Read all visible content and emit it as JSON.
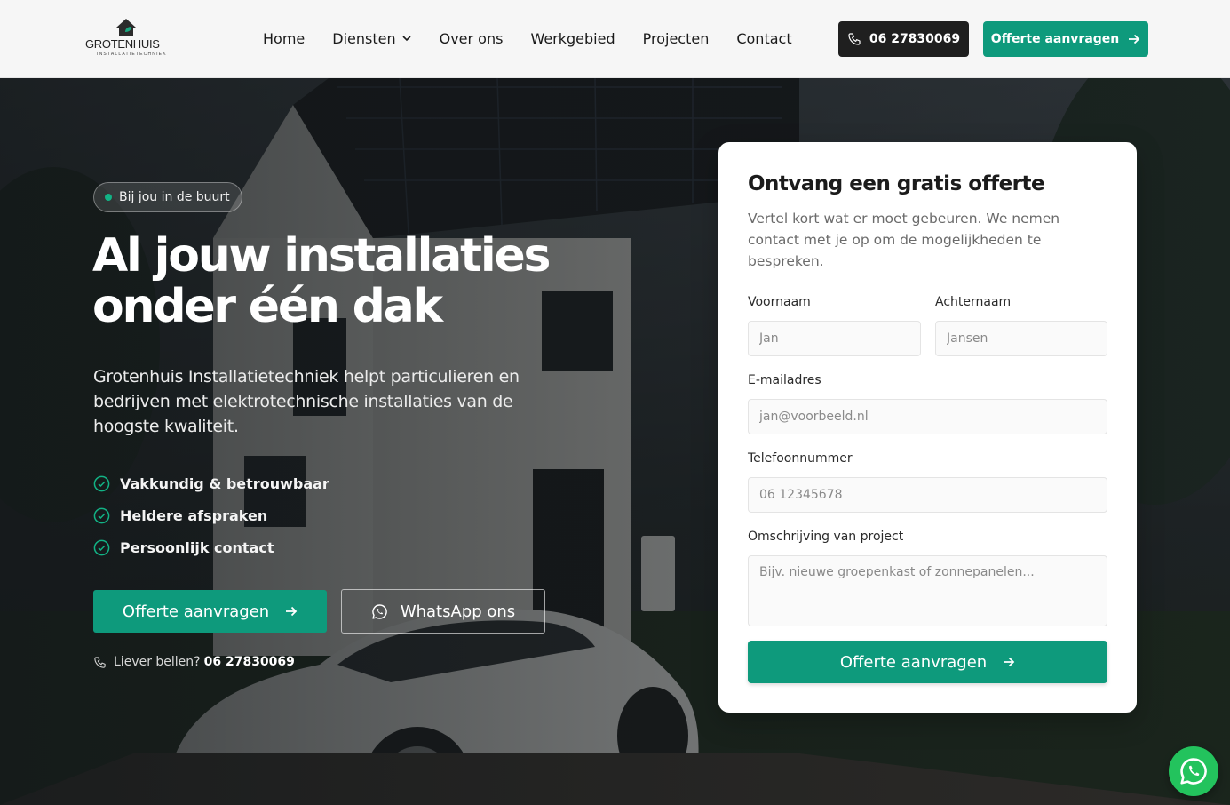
{
  "brand": {
    "name": "GROTENHUIS",
    "tagline": "INSTALLATIETECHNIEK",
    "accent": "#0e9a7c",
    "dark": "#1f1f1f"
  },
  "nav": {
    "items": [
      {
        "label": "Home"
      },
      {
        "label": "Diensten",
        "has_dropdown": true
      },
      {
        "label": "Over ons"
      },
      {
        "label": "Werkgebied"
      },
      {
        "label": "Projecten"
      },
      {
        "label": "Contact"
      }
    ],
    "phone": "06 27830069",
    "cta": "Offerte aanvragen"
  },
  "hero": {
    "badge": "Bij jou in de buurt",
    "title_line1": "Al jouw installaties",
    "title_line2": "onder één dak",
    "description": "Grotenhuis Installatietechniek helpt particulieren en bedrijven met elektrotechnische installaties van de hoogste kwaliteit.",
    "features": [
      "Vakkundig & betrouwbaar",
      "Heldere afspraken",
      "Persoonlijk contact"
    ],
    "primary_button": "Offerte aanvragen",
    "secondary_button": "WhatsApp ons",
    "call_prefix": "Liever bellen?",
    "call_number": "06 27830069"
  },
  "form": {
    "title": "Ontvang een gratis offerte",
    "subtitle": "Vertel kort wat er moet gebeuren. We nemen contact met je op om de mogelijkheden te bespreken.",
    "first_name": {
      "label": "Voornaam",
      "placeholder": "Jan",
      "value": ""
    },
    "last_name": {
      "label": "Achternaam",
      "placeholder": "Jansen",
      "value": ""
    },
    "email": {
      "label": "E-mailadres",
      "placeholder": "jan@voorbeeld.nl",
      "value": ""
    },
    "phone": {
      "label": "Telefoonnummer",
      "placeholder": "06 12345678",
      "value": ""
    },
    "description": {
      "label": "Omschrijving van project",
      "placeholder": "Bijv. nieuwe groepenkast of zonnepanelen...",
      "value": ""
    },
    "submit": "Offerte aanvragen"
  },
  "icons": {
    "logo": "house-leaf-icon",
    "dropdown": "chevron-down-icon",
    "phone": "phone-icon",
    "arrow": "arrow-right-icon",
    "check": "check-circle-icon",
    "whatsapp": "whatsapp-icon"
  }
}
